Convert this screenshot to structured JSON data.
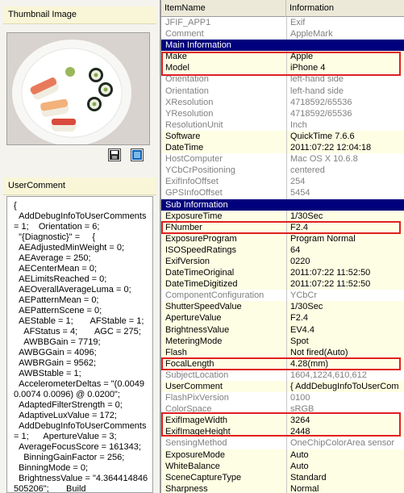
{
  "left_panel": {
    "thumbnail_title": "Thumbnail Image",
    "usercomment_title": "UserComment",
    "usercomment_text": "{\n  AddDebugInfoToUserComments = 1;    Orientation = 6;\n  \"{Diagnostic}\" =     {\n  AEAdjustedMinWeight = 0;\n  AEAverage = 250;\n  AECenterMean = 0;\n  AELimitsReached = 0;\n  AEOverallAverageLuma = 0;\n  AEPatternMean = 0;\n  AEPatternScene = 0;\n  AEStable = 1;       AFStable = 1;\n    AFStatus = 4;       AGC = 275;\n    AWBBGain = 7719;\n  AWBGGain = 4096;\n  AWBRGain = 9562;\n  AWBStable = 1;\n  AccelerometerDeltas = \"(0.0049 0.0074 0.0096) @ 0.0200\";\n  AdaptedFilterStrength = 0;\n  AdaptiveLuxValue = 172;\n  AddDebugInfoToUserComments = 1;      ApertureValue = 3;\n  AverageFocusScore = 161343;\n    BinningGainFactor = 256;\n  BinningMode = 0;\n  BrightnessValue = \"4.364414846505206\";       Build"
  },
  "icons": {
    "save": "floppy-disk-icon",
    "view": "monitor-icon"
  },
  "table": {
    "columns": [
      "ItemName",
      "Information"
    ],
    "rows": [
      {
        "name": "JFIF_APP1",
        "value": "Exif",
        "style": "gray"
      },
      {
        "name": "Comment",
        "value": "AppleMark",
        "style": "gray"
      },
      {
        "name": "Main Information",
        "value": "",
        "style": "header"
      },
      {
        "name": "Make",
        "value": "Apple",
        "style": "yellow"
      },
      {
        "name": "Model",
        "value": "iPhone 4",
        "style": "yellow"
      },
      {
        "name": "Orientation",
        "value": "left-hand side",
        "style": "gray"
      },
      {
        "name": "Orientation",
        "value": "left-hand side",
        "style": "gray"
      },
      {
        "name": "XResolution",
        "value": "4718592/65536",
        "style": "gray"
      },
      {
        "name": "YResolution",
        "value": "4718592/65536",
        "style": "gray"
      },
      {
        "name": "ResolutionUnit",
        "value": "Inch",
        "style": "gray"
      },
      {
        "name": "Software",
        "value": "QuickTime 7.6.6",
        "style": "yellow"
      },
      {
        "name": "DateTime",
        "value": "2011:07:22 12:04:18",
        "style": "yellow"
      },
      {
        "name": "HostComputer",
        "value": "Mac OS X 10.6.8",
        "style": "gray"
      },
      {
        "name": "YCbCrPositioning",
        "value": "centered",
        "style": "gray"
      },
      {
        "name": "ExifInfoOffset",
        "value": "254",
        "style": "gray"
      },
      {
        "name": "GPSInfoOffset",
        "value": "5454",
        "style": "gray"
      },
      {
        "name": "Sub Information",
        "value": "",
        "style": "header"
      },
      {
        "name": "ExposureTime",
        "value": "1/30Sec",
        "style": "yellow"
      },
      {
        "name": "FNumber",
        "value": "F2.4",
        "style": "yellow"
      },
      {
        "name": "ExposureProgram",
        "value": "Program Normal",
        "style": "yellow"
      },
      {
        "name": "ISOSpeedRatings",
        "value": "64",
        "style": "yellow"
      },
      {
        "name": "ExifVersion",
        "value": "0220",
        "style": "yellow"
      },
      {
        "name": "DateTimeOriginal",
        "value": "2011:07:22 11:52:50",
        "style": "yellow"
      },
      {
        "name": "DateTimeDigitized",
        "value": "2011:07:22 11:52:50",
        "style": "yellow"
      },
      {
        "name": "ComponentConfiguration",
        "value": "YCbCr",
        "style": "gray"
      },
      {
        "name": "ShutterSpeedValue",
        "value": "1/30Sec",
        "style": "yellow"
      },
      {
        "name": "ApertureValue",
        "value": "F2.4",
        "style": "yellow"
      },
      {
        "name": "BrightnessValue",
        "value": "EV4.4",
        "style": "yellow"
      },
      {
        "name": "MeteringMode",
        "value": "Spot",
        "style": "yellow"
      },
      {
        "name": "Flash",
        "value": "Not fired(Auto)",
        "style": "yellow"
      },
      {
        "name": "FocalLength",
        "value": "4.28(mm)",
        "style": "yellow"
      },
      {
        "name": "SubjectLocation",
        "value": "1604,1224,610,612",
        "style": "gray"
      },
      {
        "name": "UserComment",
        "value": "{    AddDebugInfoToUserCom",
        "style": "yellow"
      },
      {
        "name": "FlashPixVersion",
        "value": "0100",
        "style": "gray"
      },
      {
        "name": "ColorSpace",
        "value": "sRGB",
        "style": "gray"
      },
      {
        "name": "ExifImageWidth",
        "value": "3264",
        "style": "yellow"
      },
      {
        "name": "ExifImageHeight",
        "value": "2448",
        "style": "yellow"
      },
      {
        "name": "SensingMethod",
        "value": "OneChipColorArea sensor",
        "style": "gray"
      },
      {
        "name": "ExposureMode",
        "value": "Auto",
        "style": "yellow"
      },
      {
        "name": "WhiteBalance",
        "value": "Auto",
        "style": "yellow"
      },
      {
        "name": "SceneCaptureType",
        "value": "Standard",
        "style": "yellow"
      },
      {
        "name": "Sharpness",
        "value": "Normal",
        "style": "yellow"
      }
    ]
  }
}
